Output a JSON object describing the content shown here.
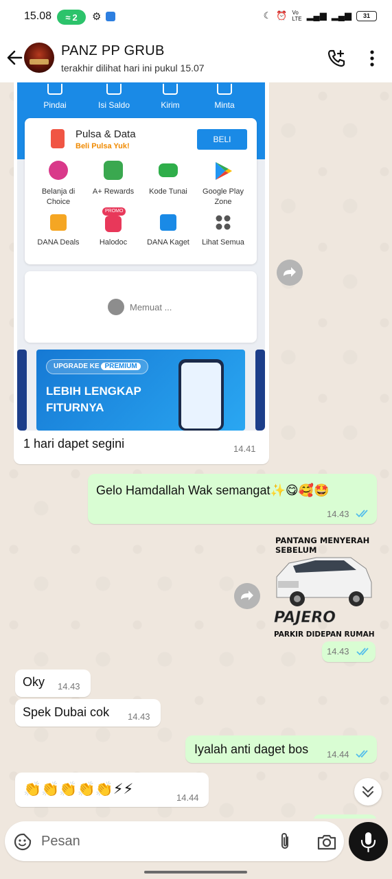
{
  "status_bar": {
    "time": "15.08",
    "hotspot_count": "2",
    "battery": "31"
  },
  "header": {
    "chat_name": "PANZ PP GRUB",
    "last_seen": "terakhir dilihat hari ini pukul 15.07"
  },
  "image_message": {
    "caption": "1 hari dapet segini",
    "time": "14.41",
    "screenshot": {
      "quick_actions": [
        "Pindai",
        "Isi Saldo",
        "Kirim",
        "Minta"
      ],
      "pulsa_title": "Pulsa & Data",
      "pulsa_sub": "Beli Pulsa Yuk!",
      "beli_label": "BELI",
      "grid": [
        {
          "label": "Belanja di Choice",
          "color": "#d9398a"
        },
        {
          "label": "A+ Rewards",
          "color": "#3aa84f"
        },
        {
          "label": "Kode Tunai",
          "color": "#2fae4a"
        },
        {
          "label": "Google Play Zone",
          "color": "#34a853"
        },
        {
          "label": "DANA Deals",
          "color": "#f5a623"
        },
        {
          "label": "Halodoc",
          "color": "#e8385a"
        },
        {
          "label": "DANA Kaget",
          "color": "#1a8ae6"
        },
        {
          "label": "Lihat Semua",
          "color": "#555555"
        }
      ],
      "promo_badge": "PROMO",
      "loading_text": "Memuat ...",
      "banner_pill": "UPGRADE KE",
      "banner_premium": "PREMIUM",
      "banner_line1": "LEBIH LENGKAP",
      "banner_line2": "FITURNYA"
    }
  },
  "messages": [
    {
      "id": "m1",
      "direction": "out",
      "text": "Gelo Hamdallah Wak semangat✨😋🥰🤩",
      "time": "14.43",
      "read": true
    },
    {
      "id": "m2",
      "direction": "out",
      "type": "sticker",
      "time": "14.43",
      "read": true
    },
    {
      "id": "m3",
      "direction": "in",
      "text": "Oky",
      "time": "14.43"
    },
    {
      "id": "m4",
      "direction": "in",
      "text": "Spek Dubai cok",
      "time": "14.43"
    },
    {
      "id": "m5",
      "direction": "out",
      "text": "Iyalah anti daget bos",
      "time": "14.44",
      "read": true
    },
    {
      "id": "m6",
      "direction": "in",
      "text": "👏👏👏👏👏⚡⚡",
      "time": "14.44"
    }
  ],
  "sticker": {
    "top_line1": "PANTANG MENYERAH",
    "top_line2": "SEBELUM",
    "brand": "PAJERO",
    "bottom": "PARKIR DIDEPAN RUMAH"
  },
  "input": {
    "placeholder": "Pesan"
  },
  "colors": {
    "outgoing_bubble": "#d9fdd3",
    "incoming_bubble": "#ffffff",
    "read_ticks": "#53bdeb",
    "dana_blue": "#1a8ae6"
  }
}
